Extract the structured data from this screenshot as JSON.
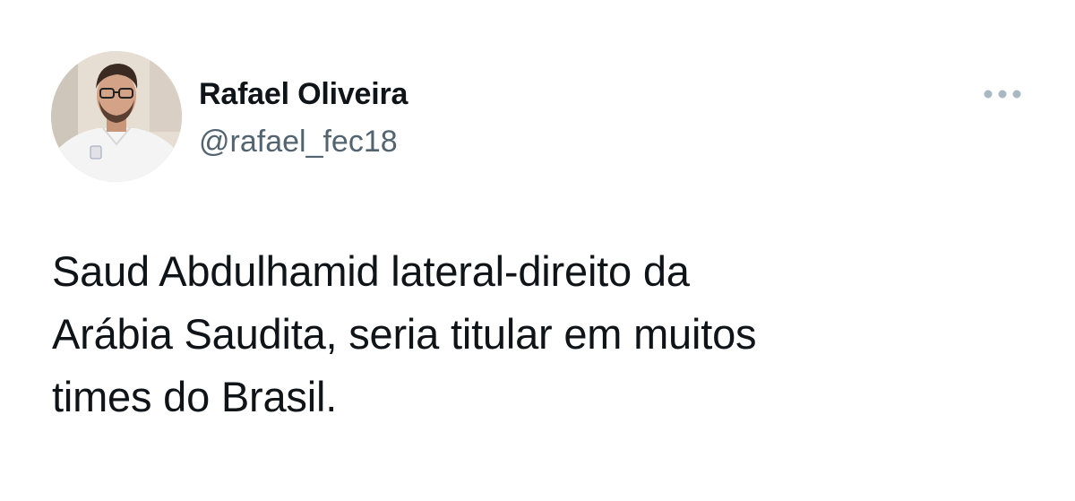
{
  "tweet": {
    "author": {
      "display_name": "Rafael Oliveira",
      "handle": "@rafael_fec18",
      "avatar_icon": "profile-photo"
    },
    "more_icon": "more-options-icon",
    "text": "Saud Abdulhamid lateral-direito da\nArábia Saudita, seria titular em muitos\ntimes do Brasil."
  },
  "colors": {
    "text_primary": "#0f1419",
    "text_secondary": "#536471",
    "icon_muted": "#aab8c2",
    "background": "#ffffff"
  }
}
